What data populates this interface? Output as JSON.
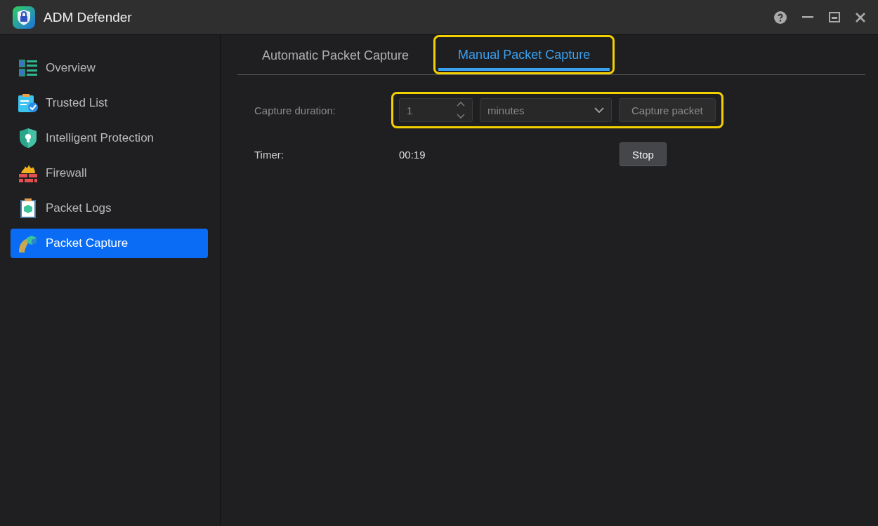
{
  "window": {
    "title": "ADM Defender"
  },
  "sidebar": {
    "items": [
      {
        "label": "Overview",
        "selected": false
      },
      {
        "label": "Trusted List",
        "selected": false
      },
      {
        "label": "Intelligent Protection",
        "selected": false
      },
      {
        "label": "Firewall",
        "selected": false
      },
      {
        "label": "Packet Logs",
        "selected": false
      },
      {
        "label": "Packet Capture",
        "selected": true
      }
    ]
  },
  "tabs": [
    {
      "label": "Automatic Packet Capture",
      "selected": false,
      "highlighted": false
    },
    {
      "label": "Manual Packet Capture",
      "selected": true,
      "highlighted": true
    }
  ],
  "capture_duration": {
    "label": "Capture duration:",
    "value": "1",
    "unit": "minutes",
    "button": "Capture packet",
    "disabled": true,
    "highlighted": true
  },
  "timer": {
    "label": "Timer:",
    "value": "00:19",
    "button": "Stop"
  }
}
